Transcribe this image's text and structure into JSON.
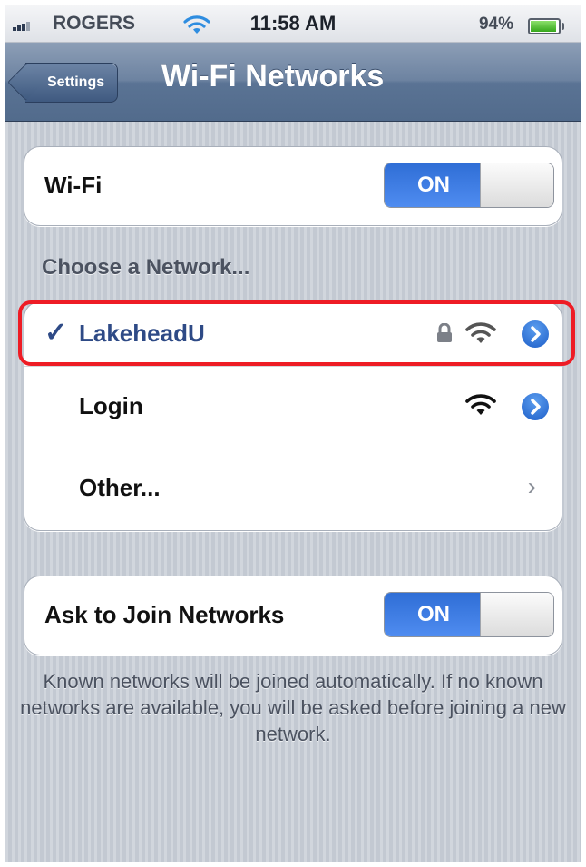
{
  "status_bar": {
    "carrier": "ROGERS",
    "time": "11:58 AM",
    "battery_percent": "94%",
    "battery_level": 0.94,
    "signal_icon": "signal-bars-icon",
    "wifi_icon": "wifi-icon",
    "battery_icon": "battery-icon"
  },
  "nav_bar": {
    "back_label": "Settings",
    "title": "Wi-Fi Networks"
  },
  "wifi_toggle": {
    "label": "Wi-Fi",
    "state_label": "ON",
    "is_on": true
  },
  "networks_section": {
    "header": "Choose a Network...",
    "networks": [
      {
        "name": "LakeheadU",
        "selected": true,
        "checkmark": "✓",
        "locked": true,
        "icons": [
          "lock-icon",
          "wifi-signal-icon",
          "detail-disclosure-icon"
        ]
      },
      {
        "name": "Login",
        "selected": false,
        "locked": false,
        "icons": [
          "wifi-signal-icon",
          "detail-disclosure-icon"
        ]
      },
      {
        "name": "Other...",
        "selected": false,
        "icons": [
          "chevron-right-icon"
        ],
        "chevron": "›"
      }
    ]
  },
  "ask_to_join": {
    "label": "Ask to Join Networks",
    "state_label": "ON",
    "is_on": true
  },
  "footer_text": "Known networks will be joined automatically.  If no known networks are available, you will be asked before joining a new network.",
  "colors": {
    "nav_bar": "#6d83a1",
    "toggle_on": "#3b7be4",
    "selected_text": "#2e4a86",
    "highlight_outline": "#ee1c25",
    "background": "#c7cdd6"
  }
}
